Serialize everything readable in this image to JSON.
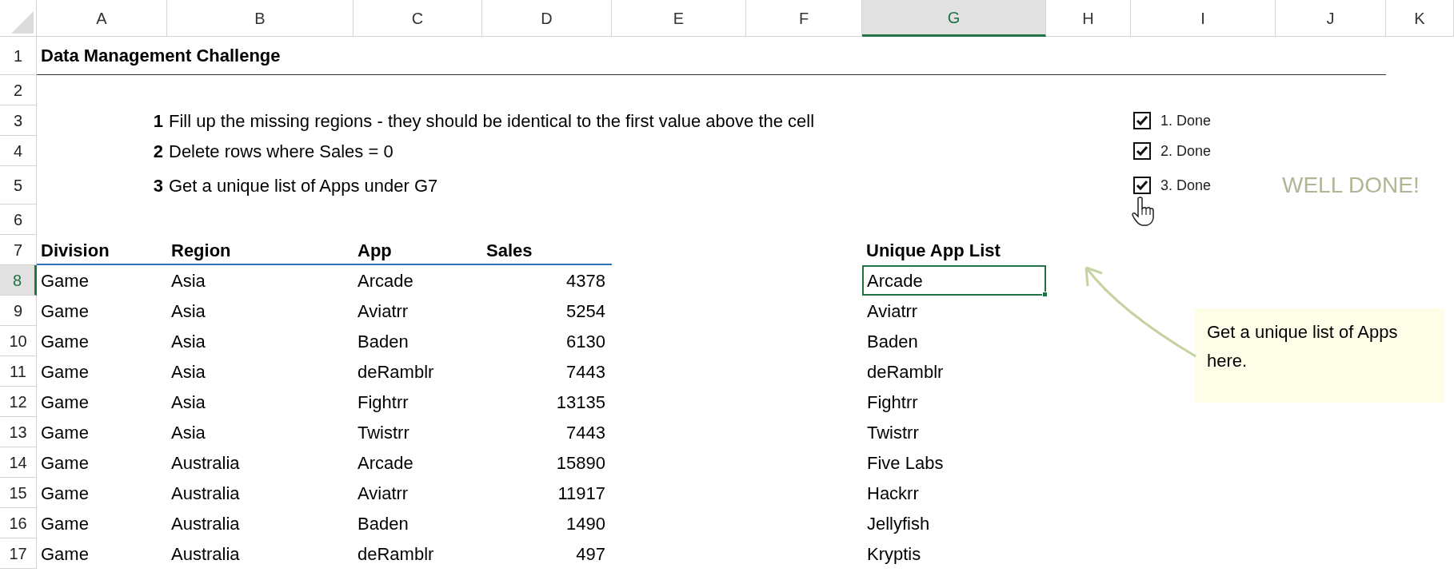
{
  "column_headers": [
    {
      "label": "A",
      "selected": false
    },
    {
      "label": "B",
      "selected": false
    },
    {
      "label": "C",
      "selected": false
    },
    {
      "label": "D",
      "selected": false
    },
    {
      "label": "E",
      "selected": false
    },
    {
      "label": "F",
      "selected": false
    },
    {
      "label": "G",
      "selected": true
    },
    {
      "label": "H",
      "selected": false
    },
    {
      "label": "I",
      "selected": false
    },
    {
      "label": "J",
      "selected": false
    },
    {
      "label": "K",
      "selected": false
    }
  ],
  "row_headers": [
    {
      "label": "1",
      "selected": false
    },
    {
      "label": "2",
      "selected": false
    },
    {
      "label": "3",
      "selected": false
    },
    {
      "label": "4",
      "selected": false
    },
    {
      "label": "5",
      "selected": false
    },
    {
      "label": "6",
      "selected": false
    },
    {
      "label": "7",
      "selected": false
    },
    {
      "label": "8",
      "selected": true
    },
    {
      "label": "9",
      "selected": false
    },
    {
      "label": "10",
      "selected": false
    },
    {
      "label": "11",
      "selected": false
    },
    {
      "label": "12",
      "selected": false
    },
    {
      "label": "13",
      "selected": false
    },
    {
      "label": "14",
      "selected": false
    },
    {
      "label": "15",
      "selected": false
    },
    {
      "label": "16",
      "selected": false
    },
    {
      "label": "17",
      "selected": false
    }
  ],
  "title": "Data Management Challenge",
  "instructions": [
    {
      "number": "1",
      "text": "Fill up the missing regions - they should be identical to the first value above the cell"
    },
    {
      "number": "2",
      "text": "Delete rows where Sales = 0"
    },
    {
      "number": "3",
      "text": "Get a unique list of Apps under G7"
    }
  ],
  "checkboxes": [
    {
      "label": "1. Done",
      "checked": true
    },
    {
      "label": "2. Done",
      "checked": true
    },
    {
      "label": "3. Done",
      "checked": true
    }
  ],
  "status_message": "WELL DONE!",
  "table": {
    "columns": [
      "Division",
      "Region",
      "App",
      "Sales"
    ],
    "rows": [
      [
        "Game",
        "Asia",
        "Arcade",
        "4378"
      ],
      [
        "Game",
        "Asia",
        "Aviatrr",
        "5254"
      ],
      [
        "Game",
        "Asia",
        "Baden",
        "6130"
      ],
      [
        "Game",
        "Asia",
        "deRamblr",
        "7443"
      ],
      [
        "Game",
        "Asia",
        "Fightrr",
        "13135"
      ],
      [
        "Game",
        "Asia",
        "Twistrr",
        "7443"
      ],
      [
        "Game",
        "Australia",
        "Arcade",
        "15890"
      ],
      [
        "Game",
        "Australia",
        "Aviatrr",
        "11917"
      ],
      [
        "Game",
        "Australia",
        "Baden",
        "1490"
      ],
      [
        "Game",
        "Australia",
        "deRamblr",
        "497"
      ]
    ]
  },
  "unique_list": {
    "header": "Unique App List",
    "items": [
      {
        "text": "Arcade",
        "selected": true
      },
      {
        "text": "Aviatrr",
        "selected": false
      },
      {
        "text": "Baden",
        "selected": false
      },
      {
        "text": "deRamblr",
        "selected": false
      },
      {
        "text": "Fightrr",
        "selected": false
      },
      {
        "text": "Twistrr",
        "selected": false
      },
      {
        "text": "Five Labs",
        "selected": false
      },
      {
        "text": "Hackrr",
        "selected": false
      },
      {
        "text": "Jellyfish",
        "selected": false
      },
      {
        "text": "Kryptis",
        "selected": false
      }
    ]
  },
  "callout": {
    "text": "Get a unique list of Apps here."
  }
}
